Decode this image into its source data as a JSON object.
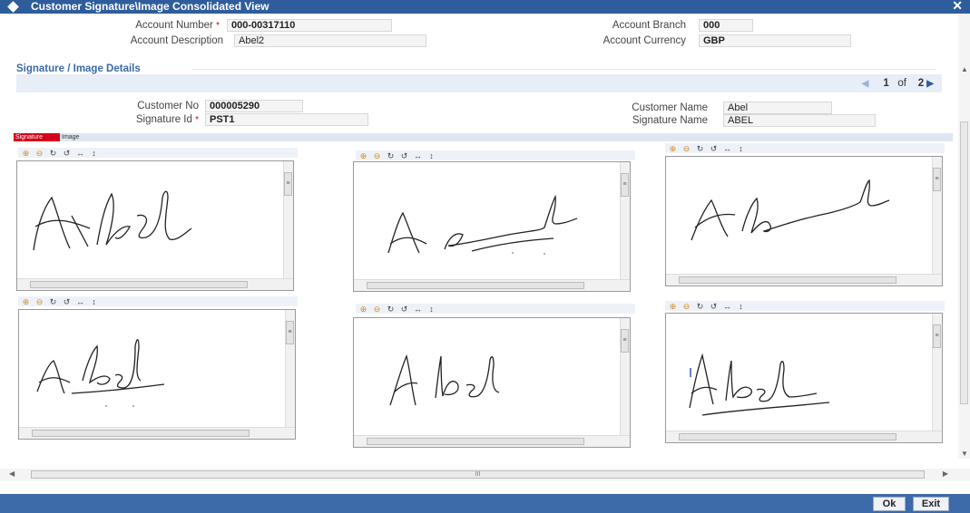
{
  "window": {
    "title": "Customer Signature\\Image Consolidated View",
    "close_glyph": "✕"
  },
  "account": {
    "number_label": "Account Number",
    "number_value": "000-00317110",
    "description_label": "Account Description",
    "description_value": "Abel2",
    "branch_label": "Account Branch",
    "branch_value": "000",
    "currency_label": "Account Currency",
    "currency_value": "GBP"
  },
  "section": {
    "title": "Signature / Image Details"
  },
  "pager": {
    "current": "1",
    "of_label": "of",
    "total": "2"
  },
  "customer": {
    "no_label": "Customer No",
    "no_value": "000005290",
    "sigid_label": "Signature Id",
    "sigid_value": "PST1",
    "name_label": "Customer Name",
    "name_value": "Abel",
    "signame_label": "Signature Name",
    "signame_value": "ABEL"
  },
  "tabs": {
    "signature": "Signature",
    "image": "Image"
  },
  "toolbar_icons": [
    "zoom-in-icon",
    "zoom-out-icon",
    "rotate-right-icon",
    "rotate-left-icon",
    "fit-width-icon",
    "fit-height-icon"
  ],
  "buttons": {
    "ok": "Ok",
    "exit": "Exit"
  },
  "colors": {
    "titlebar": "#2f5d9c",
    "footer": "#3d6aa8",
    "required": "#d00000",
    "tab_active": "#d6001c",
    "section_title": "#3a6aa8"
  }
}
